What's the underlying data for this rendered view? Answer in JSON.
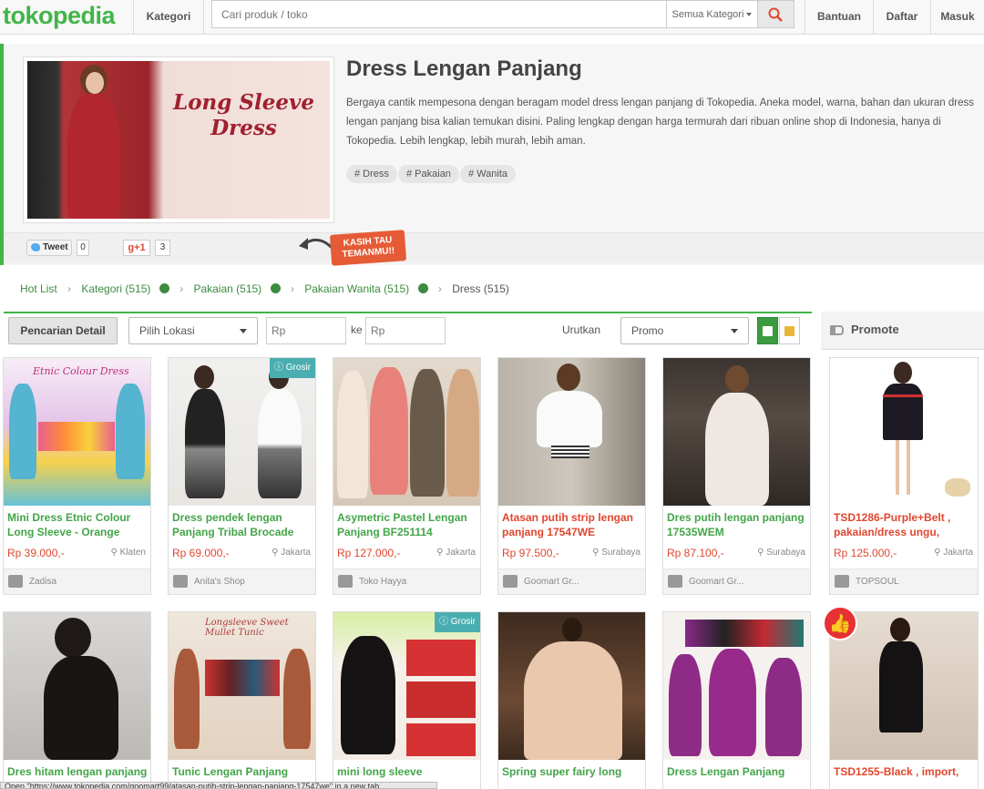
{
  "header": {
    "logo": "tokopedia",
    "kategori_label": "Kategori",
    "search_placeholder": "Cari produk / toko",
    "search_category": "Semua Kategori",
    "nav": [
      "Bantuan",
      "Daftar",
      "Masuk"
    ]
  },
  "hero": {
    "banner_text": "Long Sleeve Dress",
    "title": "Dress Lengan Panjang",
    "description": "Bergaya cantik mempesona dengan beragam model dress lengan panjang di Tokopedia. Aneka model, warna, bahan dan ukuran dress lengan panjang bisa kalian temukan disini. Paling lengkap dengan harga termurah dari ribuan online shop di Indonesia, hanya di Tokopedia. Lebih lengkap, lebih murah, lebih aman.",
    "tags": [
      "# Dress",
      "# Pakaian",
      "# Wanita"
    ]
  },
  "share": {
    "tweet_label": "Tweet",
    "tweet_count": "0",
    "gplus_label": "g+1",
    "gplus_count": "3",
    "callout": "KASIH TAU TEMANMU!!"
  },
  "breadcrumb": {
    "hot_list": "Hot List",
    "levels": [
      "Kategori (515)",
      "Pakaian (515)",
      "Pakaian Wanita (515)"
    ],
    "current": "Dress (515)"
  },
  "filter": {
    "detail_button": "Pencarian Detail",
    "location": "Pilih Lokasi",
    "price_min_placeholder": "Rp",
    "between": "ke",
    "price_max_placeholder": "Rp",
    "sort_label": "Urutkan",
    "sort_value": "Promo"
  },
  "promote": {
    "title": "Promote",
    "items": [
      {
        "name": "TSD1286-Purple+Belt , pakaian/dress ungu,",
        "price": "Rp 125.000,-",
        "location": "Jakarta",
        "shop": "TOPSOUL"
      },
      {
        "name": "TSD1255-Black , import,"
      }
    ]
  },
  "products": [
    {
      "name": "Mini Dress Etnic Colour Long Sleeve - Orange",
      "price": "Rp 39.000,-",
      "location": "Klaten",
      "shop": "Zadisa",
      "grosir": false,
      "img_text": "Etnic Colour Dress"
    },
    {
      "name": "Dress pendek lengan Panjang Tribal Brocade",
      "price": "Rp 69.000,-",
      "location": "Jakarta",
      "shop": "Anita's Shop",
      "grosir": true
    },
    {
      "name": "Asymetric Pastel Lengan Panjang BF251114",
      "price": "Rp 127.000,-",
      "location": "Jakarta",
      "shop": "Toko Hayya",
      "grosir": false
    },
    {
      "name": "Atasan putih strip lengan panjang 17547WE",
      "price": "Rp 97.500,-",
      "location": "Surabaya",
      "shop": "Goomart Gr...",
      "grosir": false
    },
    {
      "name": "Dres putih lengan panjang 17535WEM",
      "price": "Rp 87.100,-",
      "location": "Surabaya",
      "shop": "Goomart Gr...",
      "grosir": false
    },
    {
      "name": "Dres hitam lengan panjang",
      "grosir": false
    },
    {
      "name": "Tunic Lengan Panjang",
      "grosir": false
    },
    {
      "name": "mini long sleeve",
      "grosir": true
    },
    {
      "name": "Spring super fairy long",
      "grosir": false
    },
    {
      "name": "Dress Lengan Panjang",
      "grosir": false
    }
  ],
  "grosir_label": "Grosir",
  "status_bar": "Open \"https://www.tokopedia.com/goomart99/atasan-putih-strip-lengan-panjang-17547we\" in a new tab",
  "colors": {
    "brand": "#42b549",
    "price": "#e0462e",
    "grosir": "#4aaeb0",
    "callout": "#e55b35"
  }
}
